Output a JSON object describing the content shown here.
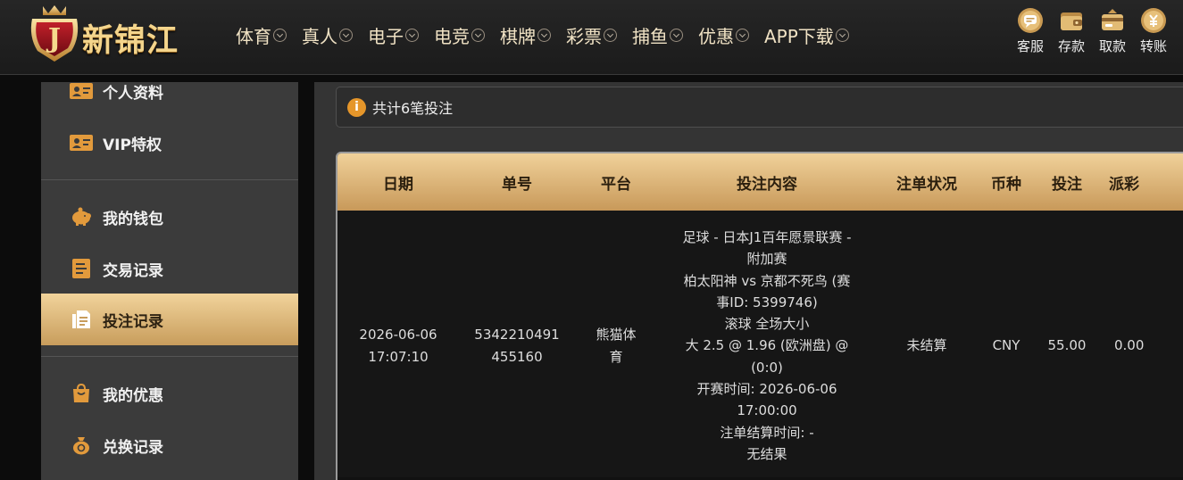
{
  "brand": {
    "name": "新锦江",
    "emblem_letter": "J"
  },
  "nav": [
    {
      "label": "体育"
    },
    {
      "label": "真人"
    },
    {
      "label": "电子"
    },
    {
      "label": "电竞"
    },
    {
      "label": "棋牌"
    },
    {
      "label": "彩票"
    },
    {
      "label": "捕鱼"
    },
    {
      "label": "优惠"
    },
    {
      "label": "APP下载"
    }
  ],
  "tools": [
    {
      "label": "客服",
      "icon": "chat-icon"
    },
    {
      "label": "存款",
      "icon": "wallet-icon"
    },
    {
      "label": "取款",
      "icon": "withdraw-icon"
    },
    {
      "label": "转账",
      "icon": "transfer-icon"
    }
  ],
  "sidebar": {
    "items": [
      {
        "label": "个人资料",
        "icon": "profile-card-icon"
      },
      {
        "label": "VIP特权",
        "icon": "vip-card-icon"
      },
      {
        "label": "我的钱包",
        "icon": "piggy-bank-icon"
      },
      {
        "label": "交易记录",
        "icon": "document-icon"
      },
      {
        "label": "投注记录",
        "icon": "bet-record-icon",
        "active": true
      },
      {
        "label": "我的优惠",
        "icon": "gift-bag-icon"
      },
      {
        "label": "兑换记录",
        "icon": "money-bag-icon"
      }
    ]
  },
  "notice": {
    "text": "共计6笔投注"
  },
  "table": {
    "headers": [
      "日期",
      "单号",
      "平台",
      "投注内容",
      "注单状况",
      "币种",
      "投注",
      "派彩"
    ],
    "rows": [
      {
        "date": "2026-06-06",
        "time": "17:07:10",
        "order_no_1": "5342210491",
        "order_no_2": "455160",
        "platform_1": "熊猫体",
        "platform_2": "育",
        "content": [
          "足球 - 日本J1百年愿景联赛 -",
          "附加赛",
          "柏太阳神 vs 京都不死鸟 (赛",
          "事ID: 5399746)",
          "滚球 全场大小",
          "大 2.5 @ 1.96 (欧洲盘) @",
          "(0:0)",
          "开赛时间: 2026-06-06",
          "17:00:00",
          "注单结算时间: -",
          "无结果"
        ],
        "status": "未结算",
        "currency": "CNY",
        "stake": "55.00",
        "payout": "0.00"
      }
    ]
  },
  "colors": {
    "accent": "#e5962a",
    "gold_light": "#f1d39b",
    "gold_dark": "#c89d5c"
  }
}
